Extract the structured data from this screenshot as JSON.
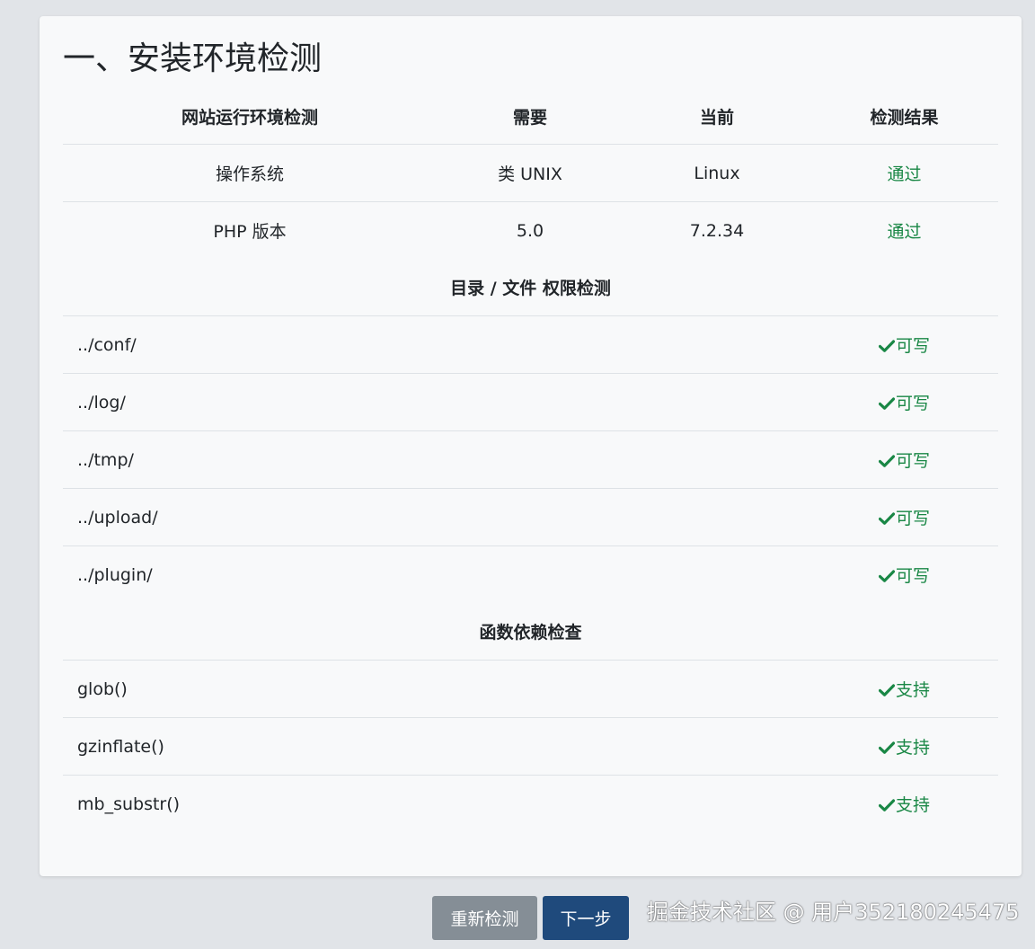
{
  "page": {
    "title": "一、安装环境检测"
  },
  "table": {
    "headers": [
      "网站运行环境检测",
      "需要",
      "当前",
      "检测结果"
    ],
    "env_rows": [
      {
        "item": "操作系统",
        "required": "类 UNIX",
        "current": "Linux",
        "result": "通过"
      },
      {
        "item": "PHP 版本",
        "required": "5.0",
        "current": "7.2.34",
        "result": "通过"
      }
    ],
    "dir_section_title": "目录 / 文件 权限检测",
    "dir_rows": [
      {
        "path": "../conf/",
        "status": "可写"
      },
      {
        "path": "../log/",
        "status": "可写"
      },
      {
        "path": "../tmp/",
        "status": "可写"
      },
      {
        "path": "../upload/",
        "status": "可写"
      },
      {
        "path": "../plugin/",
        "status": "可写"
      }
    ],
    "func_section_title": "函数依赖检查",
    "func_rows": [
      {
        "name": "glob()",
        "status": "支持"
      },
      {
        "name": "gzinflate()",
        "status": "支持"
      },
      {
        "name": "mb_substr()",
        "status": "支持"
      }
    ]
  },
  "actions": {
    "recheck_label": "重新检测",
    "next_label": "下一步"
  },
  "watermark": {
    "text": "掘金技术社区 @ 用户352180245475"
  },
  "colors": {
    "page_background": "#e1e4e8",
    "card_background": "#f8f9fa",
    "success": "#198745",
    "border": "#dee2e6",
    "recheck_button": "#858e96",
    "next_button": "#1f4a7c"
  },
  "icons": {
    "status_ok": "check-icon"
  }
}
